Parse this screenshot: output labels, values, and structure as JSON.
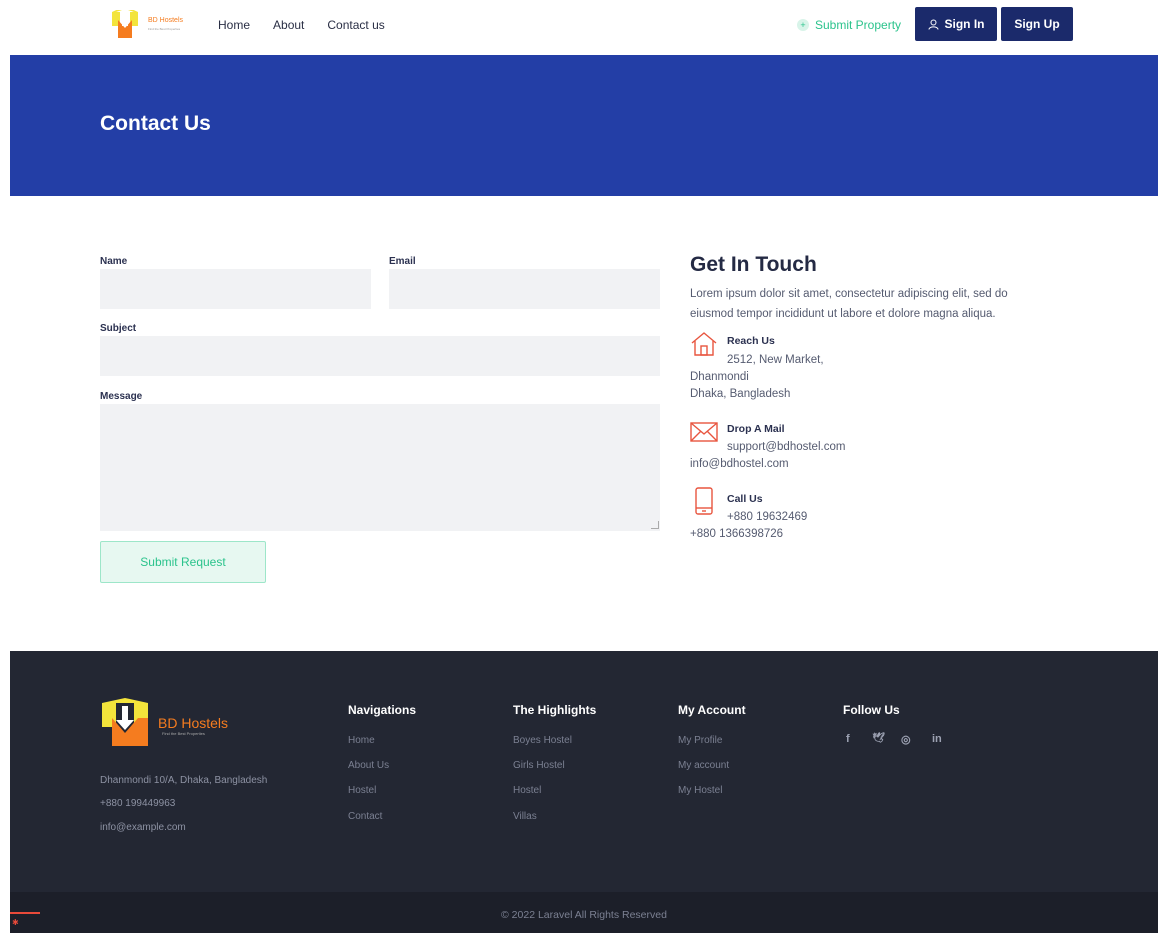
{
  "header": {
    "logo_text": "BD Hostels",
    "logo_tagline": "Find the Best Properties",
    "nav": [
      "Home",
      "About",
      "Contact us"
    ],
    "submit_property": "Submit Property",
    "sign_in": "Sign In",
    "sign_up": "Sign Up"
  },
  "banner": {
    "title": "Contact Us"
  },
  "form": {
    "name_label": "Name",
    "email_label": "Email",
    "subject_label": "Subject",
    "message_label": "Message",
    "name_value": "",
    "email_value": "",
    "subject_value": "",
    "message_value": "",
    "submit_label": "Submit Request"
  },
  "contact": {
    "title": "Get In Touch",
    "description": "Lorem ipsum dolor sit amet, consectetur adipiscing elit, sed do eiusmod tempor incididunt ut labore et dolore magna aliqua.",
    "reach": {
      "title": "Reach Us",
      "line1": "2512, New Market,",
      "line2": "Dhanmondi",
      "line3": "Dhaka, Bangladesh"
    },
    "mail": {
      "title": "Drop A Mail",
      "line1": "support@bdhostel.com",
      "line2": "info@bdhostel.com"
    },
    "call": {
      "title": "Call Us",
      "line1": "+880 19632469",
      "line2": "+880 1366398726"
    }
  },
  "footer": {
    "logo_text": "BD Hostels",
    "logo_tagline": "Find the Best Properties",
    "address": "Dhanmondi 10/A, Dhaka, Bangladesh",
    "phone": "+880 199449963",
    "email": "info@example.com",
    "navigations": {
      "title": "Navigations",
      "items": [
        "Home",
        "About Us",
        "Hostel",
        "Contact"
      ]
    },
    "highlights": {
      "title": "The Highlights",
      "items": [
        "Boyes Hostel",
        "Girls Hostel",
        "Hostel",
        "Villas"
      ]
    },
    "account": {
      "title": "My Account",
      "items": [
        "My Profile",
        "My account",
        "My Hostel"
      ]
    },
    "follow": {
      "title": "Follow Us",
      "icons": [
        "facebook-icon",
        "twitter-icon",
        "instagram-icon",
        "linkedin-icon"
      ],
      "glyphs": [
        "f",
        "🕊",
        "◎",
        "in"
      ]
    },
    "copyright": "© 2022 Laravel All Rights Reserved"
  },
  "colors": {
    "primary": "#233ea6",
    "button_dark": "#1b2a6b",
    "accent_green": "#2bc38c",
    "accent_orange": "#f57c1f",
    "icon_red": "#e8553f",
    "footer_bg": "#232733"
  }
}
